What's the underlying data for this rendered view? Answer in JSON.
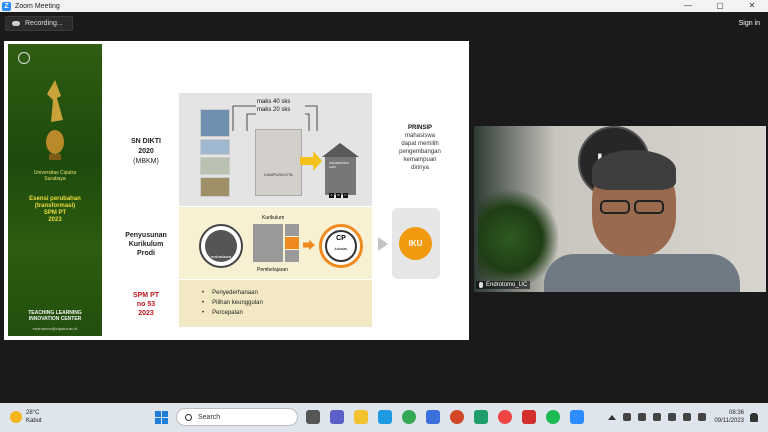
{
  "window": {
    "title": "Zoom Meeting",
    "controls": [
      "—",
      "▢",
      "✕"
    ]
  },
  "meeting": {
    "recording_label": "Recording...",
    "signin_label": "Sign in"
  },
  "slide": {
    "sidebar": {
      "university": [
        "Universitas Ciputra",
        "Surabaya"
      ],
      "esensi": [
        "Esensi perubahan",
        "(transformasi)",
        "SPM PT",
        "2023"
      ],
      "center": [
        "TEACHING LEARNING",
        "INNOVATION CENTER"
      ],
      "email": "endrotomo@ciputra.ac.id"
    },
    "sn_dikti": [
      "SN DIKTI",
      "2020",
      "(MBKM)"
    ],
    "penyusunan": [
      "Penyusunan",
      "Kurikulum",
      "Prodi"
    ],
    "spm": [
      "SPM PT",
      "no 53",
      "2023"
    ],
    "sks_max_40": "maks 40 sks",
    "sks_max_20": "maks 20 sks",
    "kampus_label": "KAMPUS/KOTA",
    "house_label": "UNIVERSITAS LAIN",
    "house_cells": [
      "A",
      "B",
      "C"
    ],
    "prinsip": {
      "title": "PRINSIP",
      "lines": [
        "mahasiswa",
        "dapat memilih",
        "pengembangan",
        "kemampuan",
        "dirinya"
      ]
    },
    "mahasiswa": "mahasiswa",
    "kurikulum": "Kurikulum",
    "pembelajaran": "Pembelajaran",
    "cp": "CP",
    "lulusan": "lulusan",
    "iku": "IKU",
    "bullets": [
      "Penyederhanaan",
      "Pilihan keunggulan",
      "Percepatan"
    ]
  },
  "video": {
    "participant_name": "Endrotomo_UC",
    "logo_text": "UC"
  },
  "taskbar": {
    "weather_temp": "28°C",
    "weather_desc": "Kabut",
    "search_placeholder": "Search",
    "time": "08:36",
    "date": "09/11/2023"
  },
  "colors": {
    "accent": "#2d8cff",
    "sidebar_green": "#2f5d12",
    "spm_red": "#c0161c",
    "orange": "#f08a1f",
    "iku_orange": "#f29a0f"
  }
}
